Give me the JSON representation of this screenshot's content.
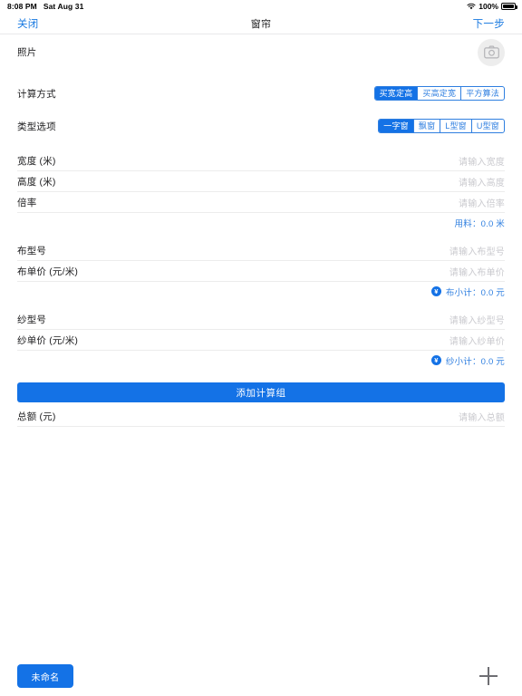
{
  "status_bar": {
    "time": "8:08 PM",
    "date": "Sat Aug 31",
    "battery_percent": "100%",
    "wifi_icon": "wifi-icon",
    "battery_icon": "battery-full-icon"
  },
  "nav": {
    "close_label": "关闭",
    "title": "窗帘",
    "next_label": "下一步"
  },
  "colors": {
    "accent": "#1472e6",
    "link": "#1778e0",
    "segment_border": "#2f7fe0",
    "placeholder": "#c9c9ce",
    "divider": "#ececec",
    "camera_bg": "#ededed"
  },
  "form": {
    "photo": {
      "label": "照片",
      "icon": "camera-icon"
    },
    "calc_method": {
      "label": "计算方式",
      "options": [
        "买宽定高",
        "买高定宽",
        "平方算法"
      ],
      "selected_index": 0
    },
    "type_option": {
      "label": "类型选项",
      "options": [
        "一字窗",
        "飘窗",
        "L型窗",
        "U型窗"
      ],
      "selected_index": 0
    },
    "fields": [
      {
        "label": "宽度 (米)",
        "placeholder": "请输入宽度",
        "value": ""
      },
      {
        "label": "高度 (米)",
        "placeholder": "请输入高度",
        "value": ""
      },
      {
        "label": "倍率",
        "placeholder": "请输入倍率",
        "value": ""
      }
    ],
    "material_summary": {
      "text": "用料：0.0 米"
    },
    "cloth_fields": [
      {
        "label": "布型号",
        "placeholder": "请输入布型号",
        "value": ""
      },
      {
        "label": "布单价 (元/米)",
        "placeholder": "请输入布单价",
        "value": ""
      }
    ],
    "cloth_subtotal": {
      "badge": "¥",
      "text": "布小计：0.0 元"
    },
    "yarn_fields": [
      {
        "label": "纱型号",
        "placeholder": "请输入纱型号",
        "value": ""
      },
      {
        "label": "纱单价 (元/米)",
        "placeholder": "请输入纱单价",
        "value": ""
      }
    ],
    "yarn_subtotal": {
      "badge": "¥",
      "text": "纱小计：0.0 元"
    },
    "add_group_button": "添加计算组",
    "total": {
      "label": "总额 (元)",
      "placeholder": "请输入总额",
      "value": ""
    }
  },
  "bottom_bar": {
    "tab_label": "未命名",
    "add_icon": "plus-icon"
  }
}
